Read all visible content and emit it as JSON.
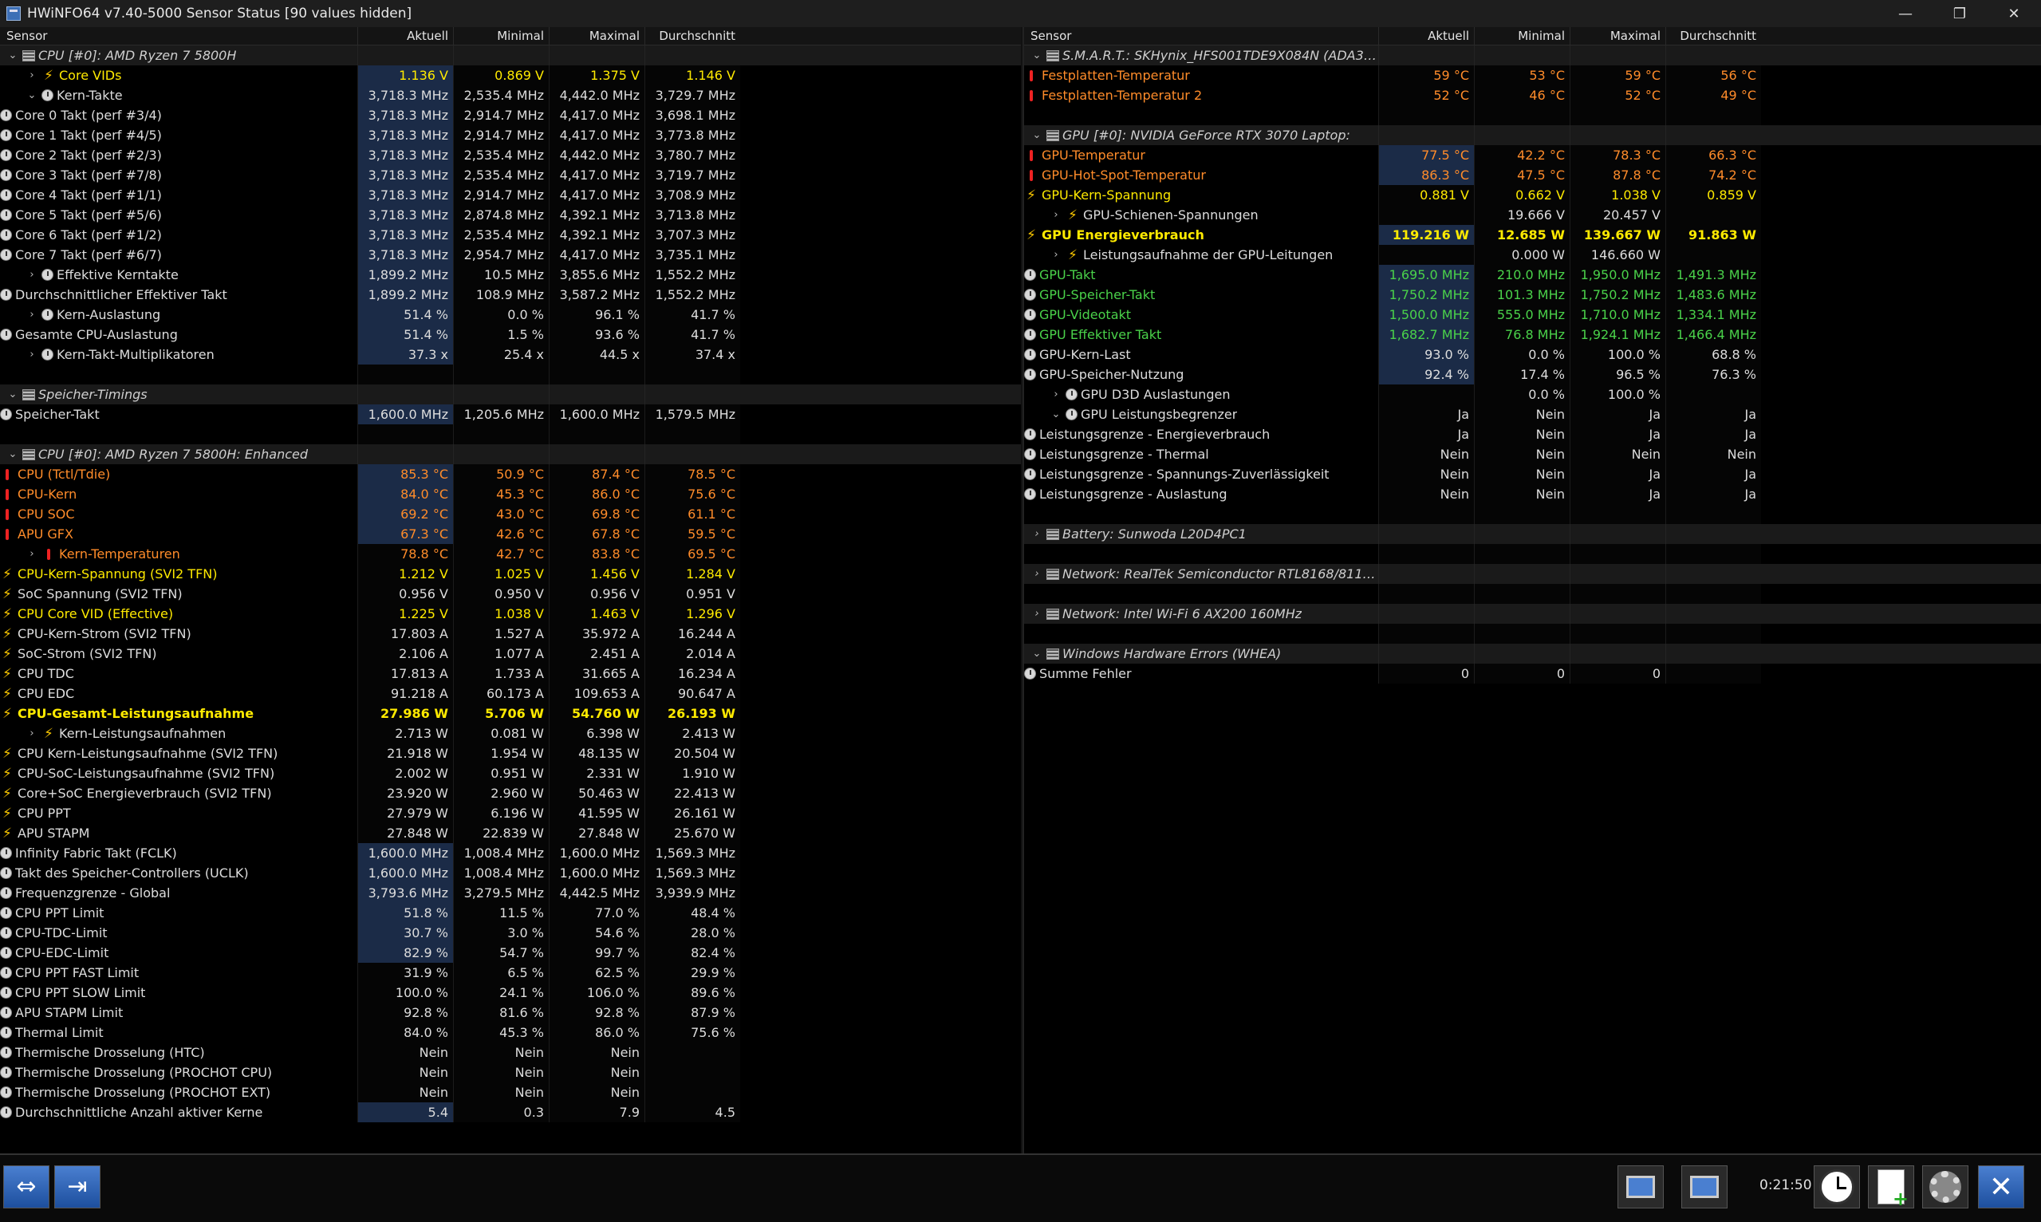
{
  "window": {
    "title": "HWiNFO64 v7.40-5000 Sensor Status [90 values hidden]",
    "minimize": "—",
    "maximize": "❐",
    "close": "✕"
  },
  "columns": {
    "sensor": "Sensor",
    "current": "Aktuell",
    "min": "Minimal",
    "max": "Maximal",
    "avg": "Durchschnitt"
  },
  "left_rows": [
    {
      "type": "group",
      "exp": "v",
      "name": "CPU [#0]: AMD Ryzen 7 5800H"
    },
    {
      "indent": 1,
      "exp": ">",
      "icon": "volt",
      "name": "Core VIDs",
      "color": "yellow",
      "v": [
        "1.136 V",
        "0.869 V",
        "1.375 V",
        "1.146 V"
      ],
      "hl": true
    },
    {
      "indent": 1,
      "exp": "v",
      "icon": "clock",
      "name": "Kern-Takte",
      "v": [
        "3,718.3 MHz",
        "2,535.4 MHz",
        "4,442.0 MHz",
        "3,729.7 MHz"
      ],
      "hl": true
    },
    {
      "indent": 2,
      "icon": "clock",
      "name": "Core 0 Takt (perf #3/4)",
      "v": [
        "3,718.3 MHz",
        "2,914.7 MHz",
        "4,417.0 MHz",
        "3,698.1 MHz"
      ],
      "hl": true
    },
    {
      "indent": 2,
      "icon": "clock",
      "name": "Core 1 Takt (perf #4/5)",
      "v": [
        "3,718.3 MHz",
        "2,914.7 MHz",
        "4,417.0 MHz",
        "3,773.8 MHz"
      ],
      "hl": true
    },
    {
      "indent": 2,
      "icon": "clock",
      "name": "Core 2 Takt (perf #2/3)",
      "v": [
        "3,718.3 MHz",
        "2,535.4 MHz",
        "4,442.0 MHz",
        "3,780.7 MHz"
      ],
      "hl": true
    },
    {
      "indent": 2,
      "icon": "clock",
      "name": "Core 3 Takt (perf #7/8)",
      "v": [
        "3,718.3 MHz",
        "2,535.4 MHz",
        "4,417.0 MHz",
        "3,719.7 MHz"
      ],
      "hl": true
    },
    {
      "indent": 2,
      "icon": "clock",
      "name": "Core 4 Takt (perf #1/1)",
      "v": [
        "3,718.3 MHz",
        "2,914.7 MHz",
        "4,417.0 MHz",
        "3,708.9 MHz"
      ],
      "hl": true
    },
    {
      "indent": 2,
      "icon": "clock",
      "name": "Core 5 Takt (perf #5/6)",
      "v": [
        "3,718.3 MHz",
        "2,874.8 MHz",
        "4,392.1 MHz",
        "3,713.8 MHz"
      ],
      "hl": true
    },
    {
      "indent": 2,
      "icon": "clock",
      "name": "Core 6 Takt (perf #1/2)",
      "v": [
        "3,718.3 MHz",
        "2,535.4 MHz",
        "4,392.1 MHz",
        "3,707.3 MHz"
      ],
      "hl": true
    },
    {
      "indent": 2,
      "icon": "clock",
      "name": "Core 7 Takt (perf #6/7)",
      "v": [
        "3,718.3 MHz",
        "2,954.7 MHz",
        "4,417.0 MHz",
        "3,735.1 MHz"
      ],
      "hl": true
    },
    {
      "indent": 1,
      "exp": ">",
      "icon": "clock",
      "name": "Effektive Kerntakte",
      "v": [
        "1,899.2 MHz",
        "10.5 MHz",
        "3,855.6 MHz",
        "1,552.2 MHz"
      ],
      "hl": true
    },
    {
      "indent": 0,
      "icon": "clock",
      "name": "Durchschnittlicher Effektiver Takt",
      "v": [
        "1,899.2 MHz",
        "108.9 MHz",
        "3,587.2 MHz",
        "1,552.2 MHz"
      ],
      "hl": true
    },
    {
      "indent": 1,
      "exp": ">",
      "icon": "clock",
      "name": "Kern-Auslastung",
      "v": [
        "51.4 %",
        "0.0 %",
        "96.1 %",
        "41.7 %"
      ],
      "hl": true
    },
    {
      "indent": 0,
      "icon": "clock",
      "name": "Gesamte CPU-Auslastung",
      "v": [
        "51.4 %",
        "1.5 %",
        "93.6 %",
        "41.7 %"
      ],
      "hl": true
    },
    {
      "indent": 1,
      "exp": ">",
      "icon": "clock",
      "name": "Kern-Takt-Multiplikatoren",
      "v": [
        "37.3 x",
        "25.4 x",
        "44.5 x",
        "37.4 x"
      ],
      "hl": true
    },
    {
      "type": "spacer"
    },
    {
      "type": "group",
      "exp": "v",
      "name": "Speicher-Timings"
    },
    {
      "indent": 0,
      "icon": "clock",
      "name": "Speicher-Takt",
      "v": [
        "1,600.0 MHz",
        "1,205.6 MHz",
        "1,600.0 MHz",
        "1,579.5 MHz"
      ],
      "hl": true
    },
    {
      "type": "spacer"
    },
    {
      "type": "group",
      "exp": "v",
      "name": "CPU [#0]: AMD Ryzen 7 5800H: Enhanced"
    },
    {
      "indent": 0,
      "icon": "therm",
      "name": "CPU (Tctl/Tdie)",
      "color": "orange",
      "v": [
        "85.3 °C",
        "50.9 °C",
        "87.4 °C",
        "78.5 °C"
      ],
      "hl": true
    },
    {
      "indent": 0,
      "icon": "therm",
      "name": "CPU-Kern",
      "color": "orange",
      "v": [
        "84.0 °C",
        "45.3 °C",
        "86.0 °C",
        "75.6 °C"
      ],
      "hl": true
    },
    {
      "indent": 0,
      "icon": "therm",
      "name": "CPU SOC",
      "color": "orange",
      "v": [
        "69.2 °C",
        "43.0 °C",
        "69.8 °C",
        "61.1 °C"
      ],
      "hl": true
    },
    {
      "indent": 0,
      "icon": "therm",
      "name": "APU GFX",
      "color": "orange",
      "v": [
        "67.3 °C",
        "42.6 °C",
        "67.8 °C",
        "59.5 °C"
      ],
      "hl": true
    },
    {
      "indent": 1,
      "exp": ">",
      "icon": "therm",
      "name": "Kern-Temperaturen",
      "color": "orange",
      "v": [
        "78.8 °C",
        "42.7 °C",
        "83.8 °C",
        "69.5 °C"
      ]
    },
    {
      "indent": 0,
      "icon": "volt",
      "name": "CPU-Kern-Spannung (SVI2 TFN)",
      "color": "yellow",
      "v": [
        "1.212 V",
        "1.025 V",
        "1.456 V",
        "1.284 V"
      ]
    },
    {
      "indent": 0,
      "icon": "volt",
      "name": "SoC Spannung (SVI2 TFN)",
      "v": [
        "0.956 V",
        "0.950 V",
        "0.956 V",
        "0.951 V"
      ]
    },
    {
      "indent": 0,
      "icon": "volt",
      "name": "CPU Core VID (Effective)",
      "color": "yellow",
      "v": [
        "1.225 V",
        "1.038 V",
        "1.463 V",
        "1.296 V"
      ]
    },
    {
      "indent": 0,
      "icon": "volt",
      "name": "CPU-Kern-Strom (SVI2 TFN)",
      "v": [
        "17.803 A",
        "1.527 A",
        "35.972 A",
        "16.244 A"
      ]
    },
    {
      "indent": 0,
      "icon": "volt",
      "name": "SoC-Strom (SVI2 TFN)",
      "v": [
        "2.106 A",
        "1.077 A",
        "2.451 A",
        "2.014 A"
      ]
    },
    {
      "indent": 0,
      "icon": "volt",
      "name": "CPU TDC",
      "v": [
        "17.813 A",
        "1.733 A",
        "31.665 A",
        "16.234 A"
      ]
    },
    {
      "indent": 0,
      "icon": "volt",
      "name": "CPU EDC",
      "v": [
        "91.218 A",
        "60.173 A",
        "109.653 A",
        "90.647 A"
      ]
    },
    {
      "indent": 0,
      "icon": "volt",
      "name": "CPU-Gesamt-Leistungsaufnahme",
      "color": "bold",
      "v": [
        "27.986 W",
        "5.706 W",
        "54.760 W",
        "26.193 W"
      ]
    },
    {
      "indent": 1,
      "exp": ">",
      "icon": "volt",
      "name": "Kern-Leistungsaufnahmen",
      "v": [
        "2.713 W",
        "0.081 W",
        "6.398 W",
        "2.413 W"
      ]
    },
    {
      "indent": 0,
      "icon": "volt",
      "name": "CPU Kern-Leistungsaufnahme (SVI2 TFN)",
      "v": [
        "21.918 W",
        "1.954 W",
        "48.135 W",
        "20.504 W"
      ]
    },
    {
      "indent": 0,
      "icon": "volt",
      "name": "CPU-SoC-Leistungsaufnahme (SVI2 TFN)",
      "v": [
        "2.002 W",
        "0.951 W",
        "2.331 W",
        "1.910 W"
      ]
    },
    {
      "indent": 0,
      "icon": "volt",
      "name": "Core+SoC Energieverbrauch (SVI2 TFN)",
      "v": [
        "23.920 W",
        "2.960 W",
        "50.463 W",
        "22.413 W"
      ]
    },
    {
      "indent": 0,
      "icon": "volt",
      "name": "CPU PPT",
      "v": [
        "27.979 W",
        "6.196 W",
        "41.595 W",
        "26.161 W"
      ]
    },
    {
      "indent": 0,
      "icon": "volt",
      "name": "APU STAPM",
      "v": [
        "27.848 W",
        "22.839 W",
        "27.848 W",
        "25.670 W"
      ]
    },
    {
      "indent": 0,
      "icon": "clock",
      "name": "Infinity Fabric Takt (FCLK)",
      "v": [
        "1,600.0 MHz",
        "1,008.4 MHz",
        "1,600.0 MHz",
        "1,569.3 MHz"
      ],
      "hl": true
    },
    {
      "indent": 0,
      "icon": "clock",
      "name": "Takt des Speicher-Controllers (UCLK)",
      "v": [
        "1,600.0 MHz",
        "1,008.4 MHz",
        "1,600.0 MHz",
        "1,569.3 MHz"
      ],
      "hl": true
    },
    {
      "indent": 0,
      "icon": "clock",
      "name": "Frequenzgrenze - Global",
      "v": [
        "3,793.6 MHz",
        "3,279.5 MHz",
        "4,442.5 MHz",
        "3,939.9 MHz"
      ],
      "hl": true
    },
    {
      "indent": 0,
      "icon": "clock",
      "name": "CPU PPT Limit",
      "v": [
        "51.8 %",
        "11.5 %",
        "77.0 %",
        "48.4 %"
      ],
      "hl": true
    },
    {
      "indent": 0,
      "icon": "clock",
      "name": "CPU-TDC-Limit",
      "v": [
        "30.7 %",
        "3.0 %",
        "54.6 %",
        "28.0 %"
      ],
      "hl": true
    },
    {
      "indent": 0,
      "icon": "clock",
      "name": "CPU-EDC-Limit",
      "v": [
        "82.9 %",
        "54.7 %",
        "99.7 %",
        "82.4 %"
      ],
      "hl": true
    },
    {
      "indent": 0,
      "icon": "clock",
      "name": "CPU PPT FAST Limit",
      "v": [
        "31.9 %",
        "6.5 %",
        "62.5 %",
        "29.9 %"
      ]
    },
    {
      "indent": 0,
      "icon": "clock",
      "name": "CPU PPT SLOW Limit",
      "v": [
        "100.0 %",
        "24.1 %",
        "106.0 %",
        "89.6 %"
      ]
    },
    {
      "indent": 0,
      "icon": "clock",
      "name": "APU STAPM Limit",
      "v": [
        "92.8 %",
        "81.6 %",
        "92.8 %",
        "87.9 %"
      ]
    },
    {
      "indent": 0,
      "icon": "clock",
      "name": "Thermal Limit",
      "v": [
        "84.0 %",
        "45.3 %",
        "86.0 %",
        "75.6 %"
      ]
    },
    {
      "indent": 0,
      "icon": "clock",
      "name": "Thermische Drosselung (HTC)",
      "v": [
        "Nein",
        "Nein",
        "Nein",
        ""
      ]
    },
    {
      "indent": 0,
      "icon": "clock",
      "name": "Thermische Drosselung (PROCHOT CPU)",
      "v": [
        "Nein",
        "Nein",
        "Nein",
        ""
      ]
    },
    {
      "indent": 0,
      "icon": "clock",
      "name": "Thermische Drosselung (PROCHOT EXT)",
      "v": [
        "Nein",
        "Nein",
        "Nein",
        ""
      ]
    },
    {
      "indent": 0,
      "icon": "clock",
      "name": "Durchschnittliche Anzahl aktiver Kerne",
      "v": [
        "5.4",
        "0.3",
        "7.9",
        "4.5"
      ],
      "hl": true
    }
  ],
  "right_rows": [
    {
      "type": "group",
      "exp": "v",
      "name": "S.M.A.R.T.: SKHynix_HFS001TDE9X084N (ADA3N6..."
    },
    {
      "indent": 0,
      "icon": "therm",
      "name": "Festplatten-Temperatur",
      "color": "orange",
      "v": [
        "59 °C",
        "53 °C",
        "59 °C",
        "56 °C"
      ]
    },
    {
      "indent": 0,
      "icon": "therm",
      "name": "Festplatten-Temperatur 2",
      "color": "orange",
      "v": [
        "52 °C",
        "46 °C",
        "52 °C",
        "49 °C"
      ]
    },
    {
      "type": "spacer"
    },
    {
      "type": "group",
      "exp": "v",
      "name": "GPU [#0]: NVIDIA GeForce RTX 3070 Laptop:"
    },
    {
      "indent": 0,
      "icon": "therm",
      "name": "GPU-Temperatur",
      "color": "orange",
      "v": [
        "77.5 °C",
        "42.2 °C",
        "78.3 °C",
        "66.3 °C"
      ],
      "hl": true
    },
    {
      "indent": 0,
      "icon": "therm",
      "name": "GPU-Hot-Spot-Temperatur",
      "color": "orange",
      "v": [
        "86.3 °C",
        "47.5 °C",
        "87.8 °C",
        "74.2 °C"
      ],
      "hl": true
    },
    {
      "indent": 0,
      "icon": "volt",
      "name": "GPU-Kern-Spannung",
      "color": "yellow",
      "v": [
        "0.881 V",
        "0.662 V",
        "1.038 V",
        "0.859 V"
      ]
    },
    {
      "indent": 1,
      "exp": ">",
      "icon": "volt",
      "name": "GPU-Schienen-Spannungen",
      "v": [
        "",
        "19.666 V",
        "20.457 V",
        ""
      ]
    },
    {
      "indent": 0,
      "icon": "volt",
      "name": "GPU Energieverbrauch",
      "color": "bold",
      "v": [
        "119.216 W",
        "12.685 W",
        "139.667 W",
        "91.863 W"
      ],
      "hl": true
    },
    {
      "indent": 1,
      "exp": ">",
      "icon": "volt",
      "name": "Leistungsaufnahme der GPU-Leitungen",
      "v": [
        "",
        "0.000 W",
        "146.660 W",
        ""
      ]
    },
    {
      "indent": 0,
      "icon": "clock",
      "name": "GPU-Takt",
      "color": "green",
      "v": [
        "1,695.0 MHz",
        "210.0 MHz",
        "1,950.0 MHz",
        "1,491.3 MHz"
      ],
      "hl": true
    },
    {
      "indent": 0,
      "icon": "clock",
      "name": "GPU-Speicher-Takt",
      "color": "green",
      "v": [
        "1,750.2 MHz",
        "101.3 MHz",
        "1,750.2 MHz",
        "1,483.6 MHz"
      ],
      "hl": true
    },
    {
      "indent": 0,
      "icon": "clock",
      "name": "GPU-Videotakt",
      "color": "green",
      "v": [
        "1,500.0 MHz",
        "555.0 MHz",
        "1,710.0 MHz",
        "1,334.1 MHz"
      ],
      "hl": true
    },
    {
      "indent": 0,
      "icon": "clock",
      "name": "GPU Effektiver Takt",
      "color": "green",
      "v": [
        "1,682.7 MHz",
        "76.8 MHz",
        "1,924.1 MHz",
        "1,466.4 MHz"
      ],
      "hl": true
    },
    {
      "indent": 0,
      "icon": "clock",
      "name": "GPU-Kern-Last",
      "v": [
        "93.0 %",
        "0.0 %",
        "100.0 %",
        "68.8 %"
      ],
      "hl": true
    },
    {
      "indent": 0,
      "icon": "clock",
      "name": "GPU-Speicher-Nutzung",
      "v": [
        "92.4 %",
        "17.4 %",
        "96.5 %",
        "76.3 %"
      ],
      "hl": true
    },
    {
      "indent": 1,
      "exp": ">",
      "icon": "clock",
      "name": "GPU D3D Auslastungen",
      "v": [
        "",
        "0.0 %",
        "100.0 %",
        ""
      ]
    },
    {
      "indent": 1,
      "exp": "v",
      "icon": "clock",
      "name": "GPU Leistungsbegrenzer",
      "v": [
        "Ja",
        "Nein",
        "Ja",
        "Ja"
      ]
    },
    {
      "indent": 2,
      "icon": "clock",
      "name": "Leistungsgrenze - Energieverbrauch",
      "v": [
        "Ja",
        "Nein",
        "Ja",
        "Ja"
      ]
    },
    {
      "indent": 2,
      "icon": "clock",
      "name": "Leistungsgrenze - Thermal",
      "v": [
        "Nein",
        "Nein",
        "Nein",
        "Nein"
      ]
    },
    {
      "indent": 2,
      "icon": "clock",
      "name": "Leistungsgrenze - Spannungs-Zuverlässigkeit",
      "v": [
        "Nein",
        "Nein",
        "Ja",
        "Ja"
      ]
    },
    {
      "indent": 2,
      "icon": "clock",
      "name": "Leistungsgrenze - Auslastung",
      "v": [
        "Nein",
        "Nein",
        "Ja",
        "Ja"
      ]
    },
    {
      "type": "spacer"
    },
    {
      "type": "group",
      "exp": ">",
      "name": "Battery: Sunwoda L20D4PC1"
    },
    {
      "type": "spacer"
    },
    {
      "type": "group",
      "exp": ">",
      "name": "Network: RealTek Semiconductor RTL8168/8111 PC..."
    },
    {
      "type": "spacer"
    },
    {
      "type": "group",
      "exp": ">",
      "name": "Network: Intel Wi-Fi 6 AX200 160MHz"
    },
    {
      "type": "spacer"
    },
    {
      "type": "group",
      "exp": "v",
      "name": "Windows Hardware Errors (WHEA)"
    },
    {
      "indent": 0,
      "icon": "clock",
      "name": "Summe Fehler",
      "v": [
        "0",
        "0",
        "0",
        ""
      ]
    }
  ],
  "footer": {
    "time": "0:21:50"
  }
}
